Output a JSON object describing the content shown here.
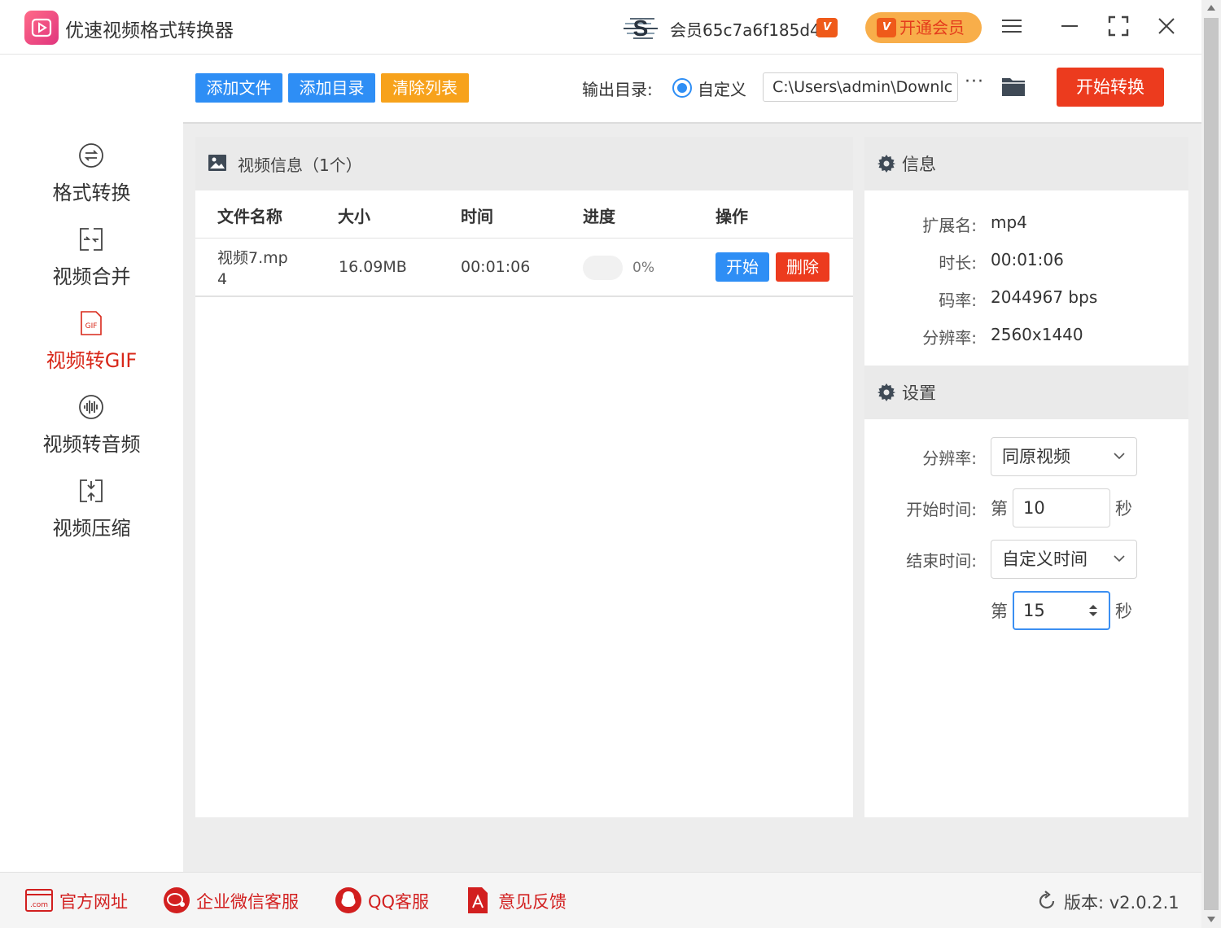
{
  "app": {
    "title": "优速视频格式转换器",
    "member_id": "会员65c7a6f185d4",
    "vip_badge": "V",
    "vip_open": "开通会员"
  },
  "sidebar": {
    "items": [
      {
        "label": "格式转换",
        "icon": "format-convert-icon"
      },
      {
        "label": "视频合并",
        "icon": "merge-icon"
      },
      {
        "label": "视频转GIF",
        "icon": "gif-file-icon",
        "active": true
      },
      {
        "label": "视频转音频",
        "icon": "audio-wave-icon"
      },
      {
        "label": "视频压缩",
        "icon": "compress-icon"
      }
    ],
    "gif_icon_text": "GIF"
  },
  "toolbar": {
    "add_file": "添加文件",
    "add_dir": "添加目录",
    "clear_list": "清除列表",
    "output_label": "输出目录:",
    "custom_label": "自定义",
    "output_path": "C:\\Users\\admin\\Downlc",
    "more": "···",
    "start_convert": "开始转换"
  },
  "file_list": {
    "title": "视频信息（1个）",
    "columns": [
      "文件名称",
      "大小",
      "时间",
      "进度",
      "操作"
    ],
    "rows": [
      {
        "name_line1": "视频7.mp",
        "name_line2": "4",
        "size": "16.09MB",
        "time": "00:01:06",
        "progress": 0,
        "progress_text": "0%",
        "start": "开始",
        "delete": "删除"
      }
    ]
  },
  "info": {
    "title": "信息",
    "ext_label": "扩展名:",
    "ext": "mp4",
    "duration_label": "时长:",
    "duration": "00:01:06",
    "bitrate_label": "码率:",
    "bitrate": "2044967 bps",
    "resolution_label": "分辨率:",
    "resolution": "2560x1440"
  },
  "settings": {
    "title": "设置",
    "resolution_label": "分辨率:",
    "resolution_value": "同原视频",
    "start_label": "开始时间:",
    "prefix": "第",
    "start_value": "10",
    "unit": "秒",
    "end_label": "结束时间:",
    "end_mode": "自定义时间",
    "end_value": "15"
  },
  "footer": {
    "website": "官方网址",
    "wechat": "企业微信客服",
    "qq": "QQ客服",
    "feedback": "意见反馈",
    "version": "版本: v2.0.2.1",
    "com_icon_text": ".com"
  },
  "colors": {
    "blue": "#2e8ef5",
    "orange": "#f7a21b",
    "red": "#ec3b1e",
    "active_nav": "#d8281a"
  }
}
